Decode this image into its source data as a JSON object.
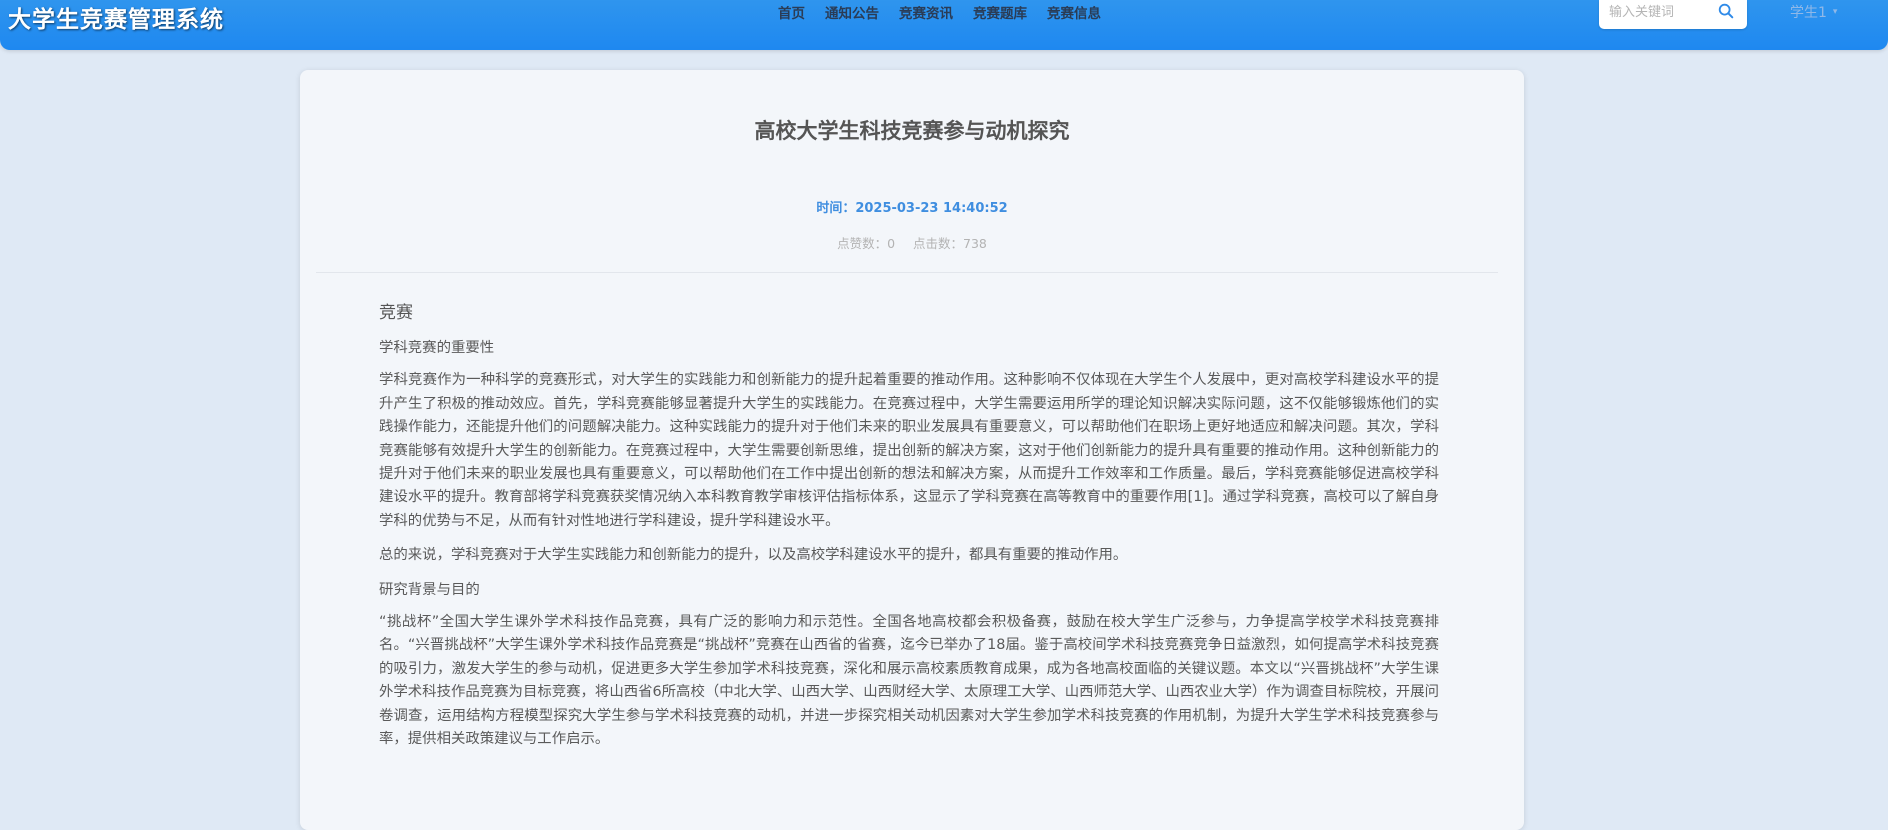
{
  "header": {
    "brand": "大学生竞赛管理系统",
    "nav": [
      "首页",
      "通知公告",
      "竞赛资讯",
      "竞赛题库",
      "竞赛信息"
    ],
    "search": {
      "placeholder": "输入关键词"
    },
    "user": "学生1"
  },
  "article": {
    "title": "高校大学生科技竞赛参与动机探究",
    "time": "时间：2025-03-23 14:40:52",
    "likes": "点赞数：0",
    "clicks": "点击数：738",
    "heading": "竞赛",
    "sections": [
      "学科竞赛的重要性",
      "学科竞赛作为一种科学的竞赛形式，对大学生的实践能力和创新能力的提升起着重要的推动作用。这种影响不仅体现在大学生个人发展中，更对高校学科建设水平的提升产生了积极的推动效应。首先，学科竞赛能够显著提升大学生的实践能力。在竞赛过程中，大学生需要运用所学的理论知识解决实际问题，这不仅能够锻炼他们的实践操作能力，还能提升他们的问题解决能力。这种实践能力的提升对于他们未来的职业发展具有重要意义，可以帮助他们在职场上更好地适应和解决问题。其次，学科竞赛能够有效提升大学生的创新能力。在竞赛过程中，大学生需要创新思维，提出创新的解决方案，这对于他们创新能力的提升具有重要的推动作用。这种创新能力的提升对于他们未来的职业发展也具有重要意义，可以帮助他们在工作中提出创新的想法和解决方案，从而提升工作效率和工作质量。最后，学科竞赛能够促进高校学科建设水平的提升。教育部将学科竞赛获奖情况纳入本科教育教学审核评估指标体系，这显示了学科竞赛在高等教育中的重要作用[1]。通过学科竞赛，高校可以了解自身学科的优势与不足，从而有针对性地进行学科建设，提升学科建设水平。",
      "总的来说，学科竞赛对于大学生实践能力和创新能力的提升，以及高校学科建设水平的提升，都具有重要的推动作用。",
      "研究背景与目的",
      "“挑战杯”全国大学生课外学术科技作品竞赛，具有广泛的影响力和示范性。全国各地高校都会积极备赛，鼓励在校大学生广泛参与，力争提高学校学术科技竞赛排名。“兴晋挑战杯”大学生课外学术科技作品竞赛是“挑战杯”竞赛在山西省的省赛，迄今已举办了18届。鉴于高校间学术科技竞赛竞争日益激烈，如何提高学术科技竞赛的吸引力，激发大学生的参与动机，促进更多大学生参加学术科技竞赛，深化和展示高校素质教育成果，成为各地高校面临的关键议题。本文以“兴晋挑战杯”大学生课外学术科技作品竞赛为目标竞赛，将山西省6所高校（中北大学、山西大学、山西财经大学、太原理工大学、山西师范大学、山西农业大学）作为调查目标院校，开展问卷调查，运用结构方程模型探究大学生参与学术科技竞赛的动机，并进一步探究相关动机因素对大学生参加学术科技竞赛的作用机制，为提升大学生学术科技竞赛参与率，提供相关政策建议与工作启示。"
    ]
  }
}
